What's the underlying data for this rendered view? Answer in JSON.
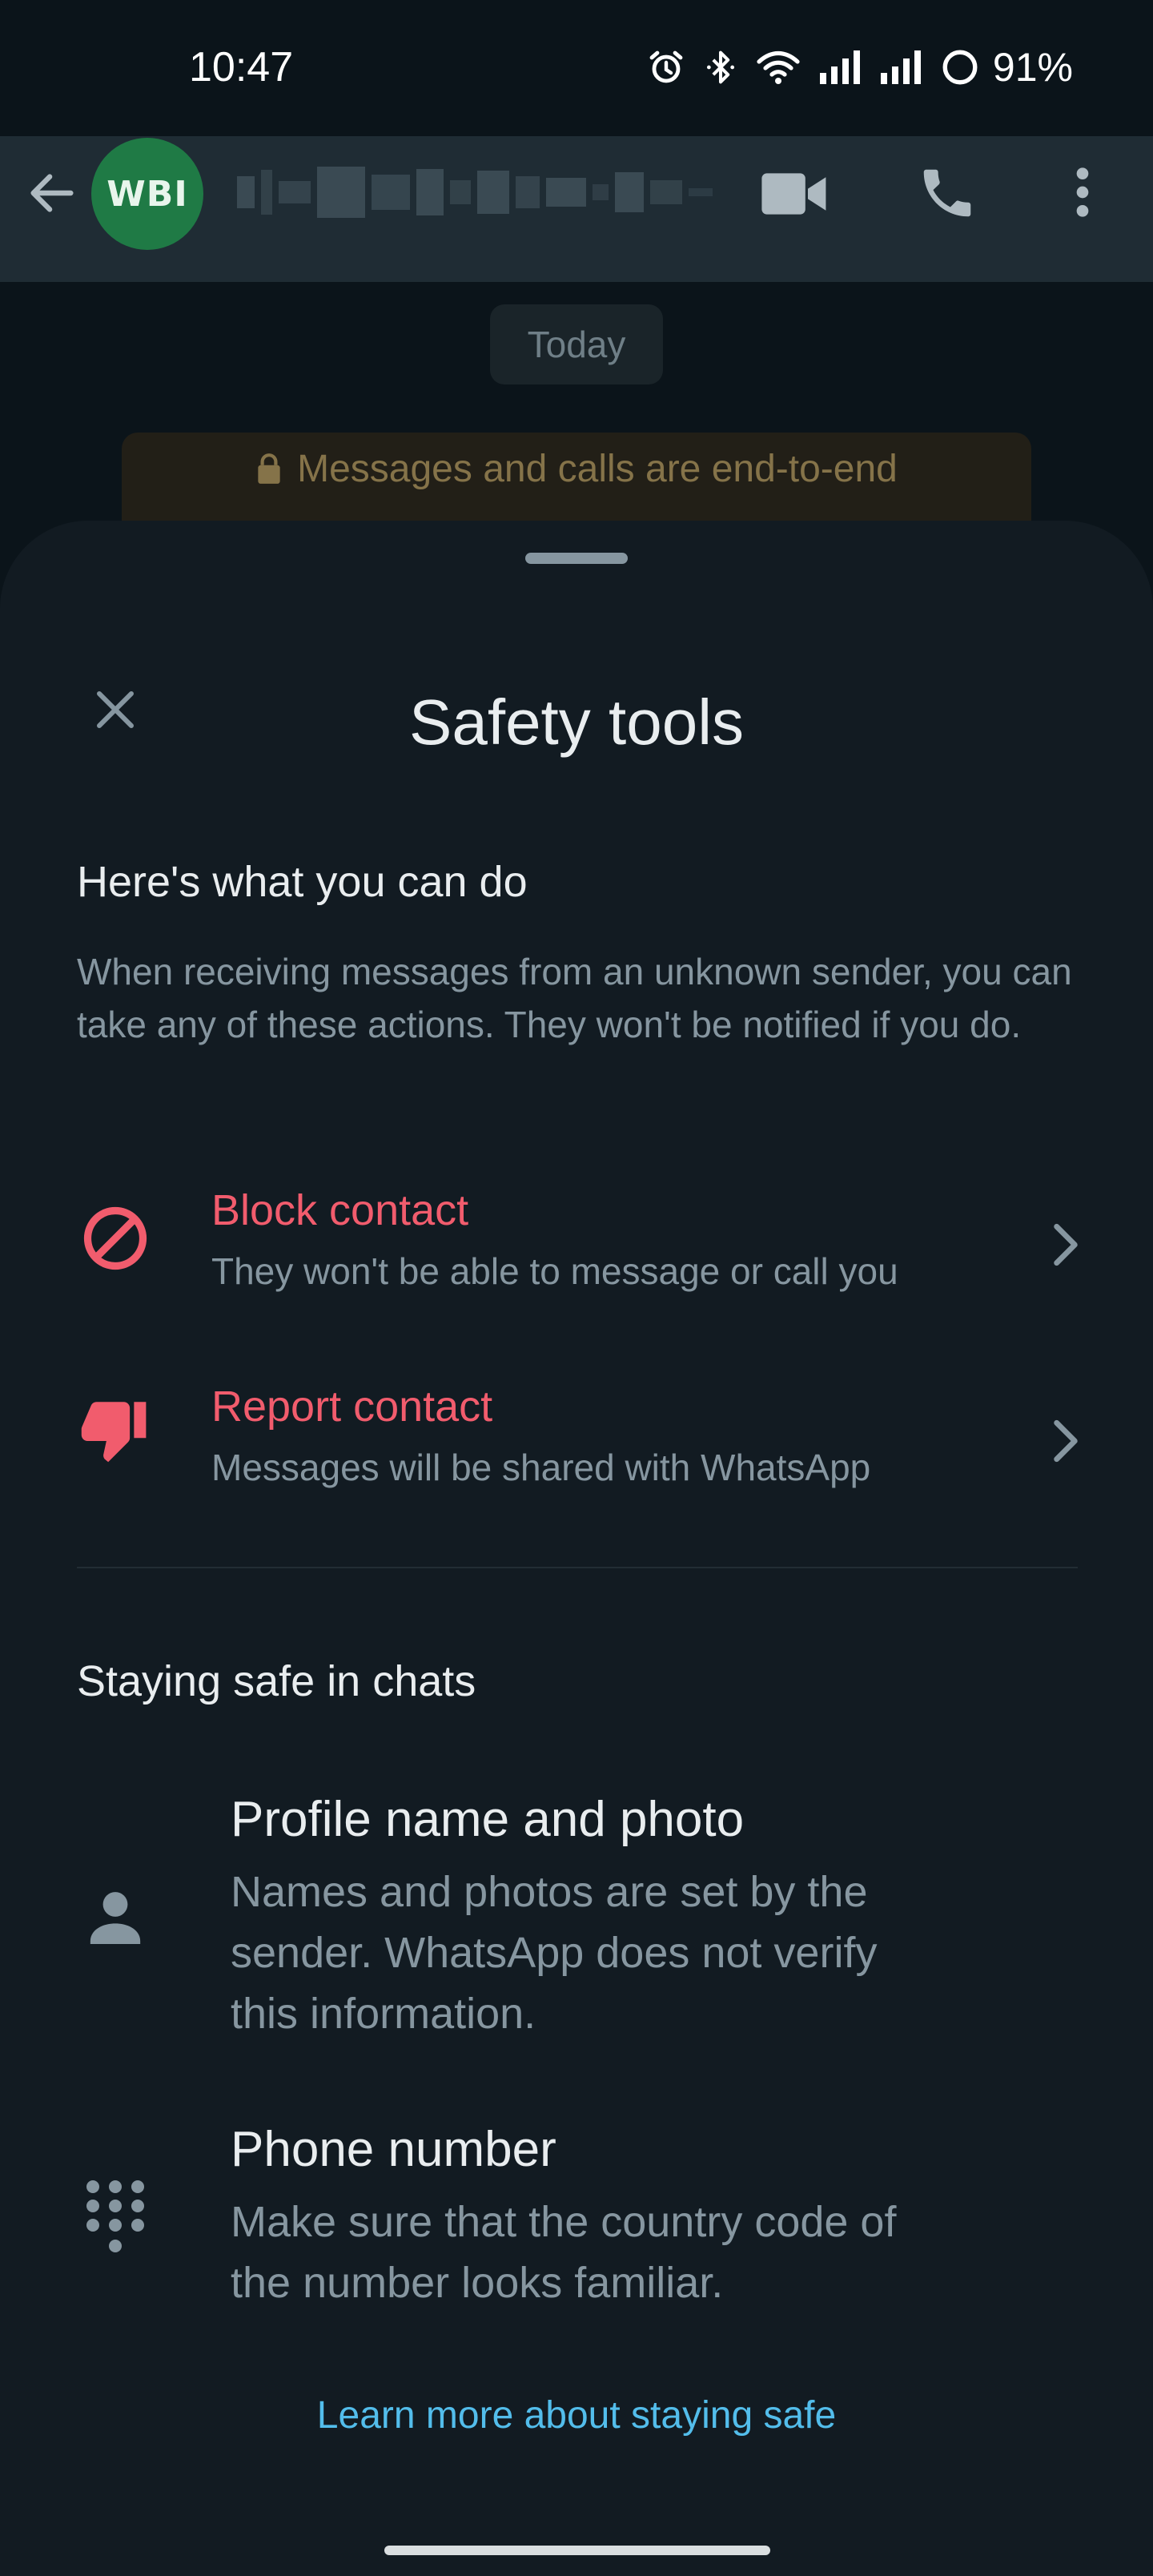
{
  "status_bar": {
    "time": "10:47",
    "battery": "91%",
    "icons": [
      "alarm-icon",
      "bluetooth-icon",
      "wifi-icon",
      "signal-icon",
      "signal-icon",
      "battery-icon"
    ]
  },
  "header": {
    "avatar_initials": "WBI",
    "contact_name_redacted": true,
    "icons": [
      "back-arrow-icon",
      "video-call-icon",
      "voice-call-icon",
      "more-options-icon"
    ]
  },
  "chat": {
    "date_chip": "Today",
    "encryption_notice": "Messages and calls are end-to-end"
  },
  "sheet": {
    "title": "Safety tools",
    "section_actions": {
      "heading": "Here's what you can do",
      "intro": "When receiving messages from an unknown sender, you can take any of these actions. They won't be notified if you do.",
      "items": [
        {
          "title": "Block contact",
          "subtitle": "They won't be able to message or call you",
          "icon": "block-icon"
        },
        {
          "title": "Report contact",
          "subtitle": "Messages will be shared with WhatsApp",
          "icon": "thumbs-down-icon"
        }
      ]
    },
    "section_tips": {
      "heading": "Staying safe in chats",
      "items": [
        {
          "title": "Profile name and photo",
          "description": "Names and photos are set by the sender. WhatsApp does not verify this information.",
          "icon": "person-icon"
        },
        {
          "title": "Phone number",
          "description": "Make sure that the country code of the number looks familiar.",
          "icon": "dialpad-icon"
        }
      ]
    },
    "learn_more": "Learn more about staying safe"
  },
  "colors": {
    "danger": "#f15c6d",
    "link": "#53bdeb",
    "sheet_bg": "#121b22",
    "muted_text": "#8696a0",
    "avatar_bg": "#1f7a45"
  }
}
